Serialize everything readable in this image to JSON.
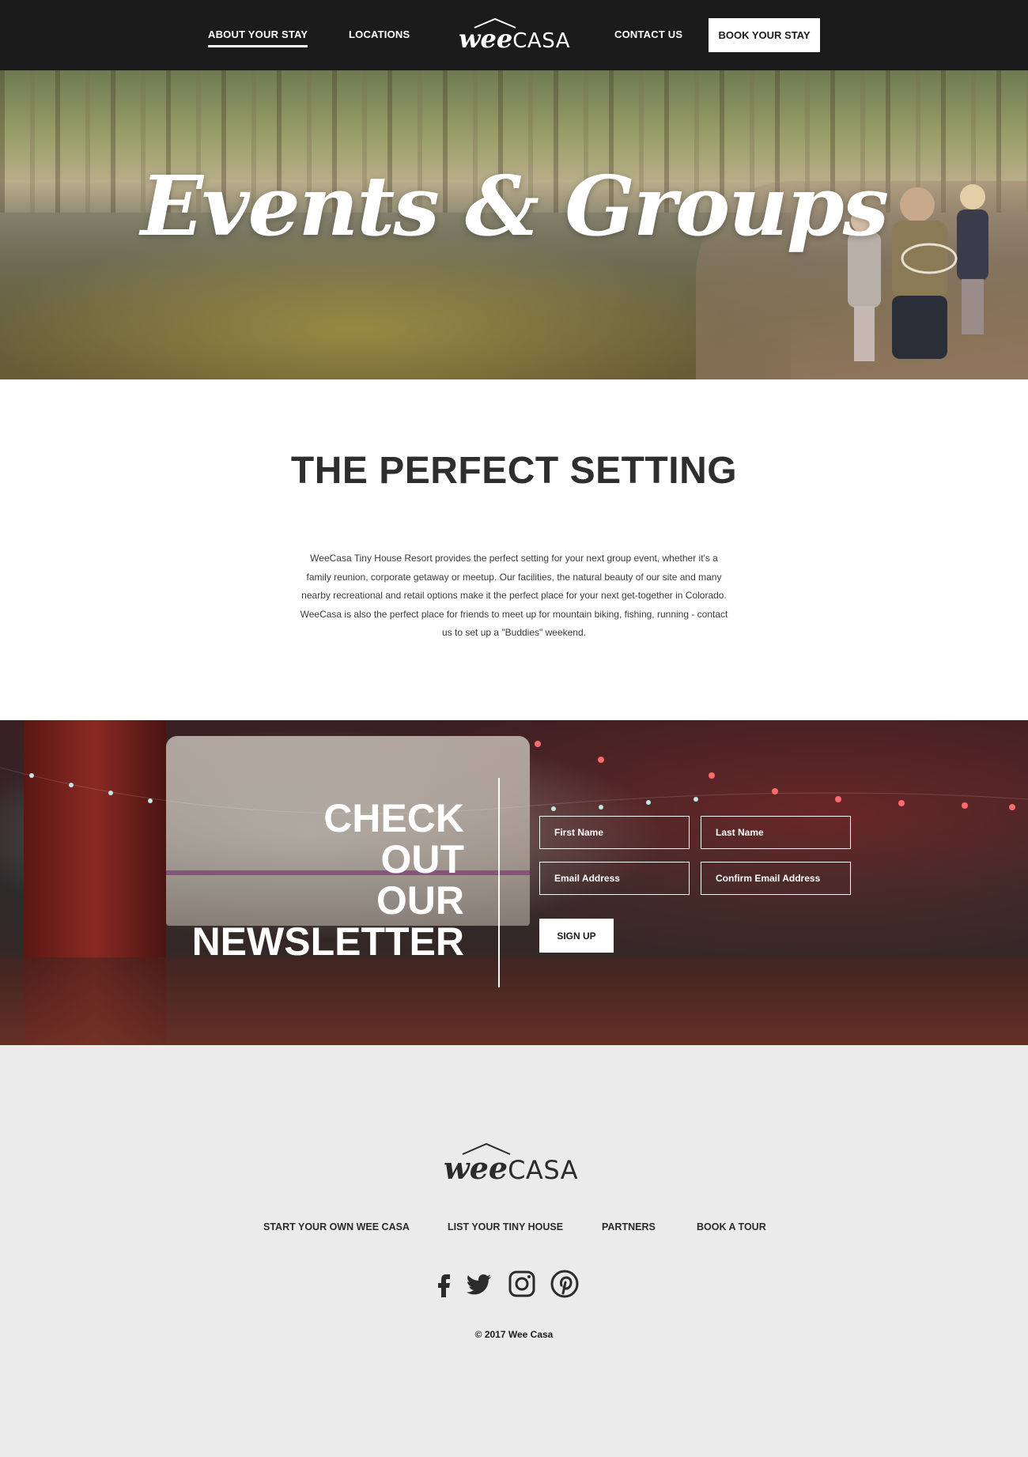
{
  "nav": {
    "items": [
      {
        "label": "ABOUT YOUR STAY"
      },
      {
        "label": "LOCATIONS"
      },
      {
        "label": "CONTACT US"
      }
    ],
    "logo": {
      "wee": "wee",
      "casa": "CASA"
    },
    "book_button": "BOOK YOUR STAY"
  },
  "hero": {
    "title": "Events & Groups"
  },
  "setting": {
    "heading": "THE PERFECT SETTING",
    "body": "WeeCasa Tiny House Resort provides the perfect setting for your next group event, whether it's a family reunion, corporate getaway or meetup. Our facilities, the natural beauty of our site and many nearby recreational and retail options make it the perfect place for your next get-together in Colorado. WeeCasa is also the perfect place for friends to meet up for mountain biking, fishing, running - contact us to set up a \"Buddies\" weekend."
  },
  "newsletter": {
    "title_lines": [
      "CHECK",
      "OUT",
      "OUR",
      "NEWSLETTER"
    ],
    "fields": {
      "first_name": "First Name",
      "last_name": "Last Name",
      "email": "Email Address",
      "confirm_email": "Confirm Email Address"
    },
    "signup_button": "SIGN UP"
  },
  "footer": {
    "logo": {
      "wee": "wee",
      "casa": "CASA"
    },
    "links": [
      {
        "label": "START YOUR OWN WEE CASA"
      },
      {
        "label": "LIST YOUR TINY HOUSE"
      },
      {
        "label": "PARTNERS"
      },
      {
        "label": "BOOK A TOUR"
      }
    ],
    "social_icons": [
      "facebook-icon",
      "twitter-icon",
      "instagram-icon",
      "pinterest-icon"
    ],
    "copyright": "© 2017 Wee Casa"
  },
  "colors": {
    "nav_background": "#1b1b1b",
    "footer_background": "#ebebeb",
    "text_dark": "#2b2b2b",
    "white": "#ffffff"
  }
}
